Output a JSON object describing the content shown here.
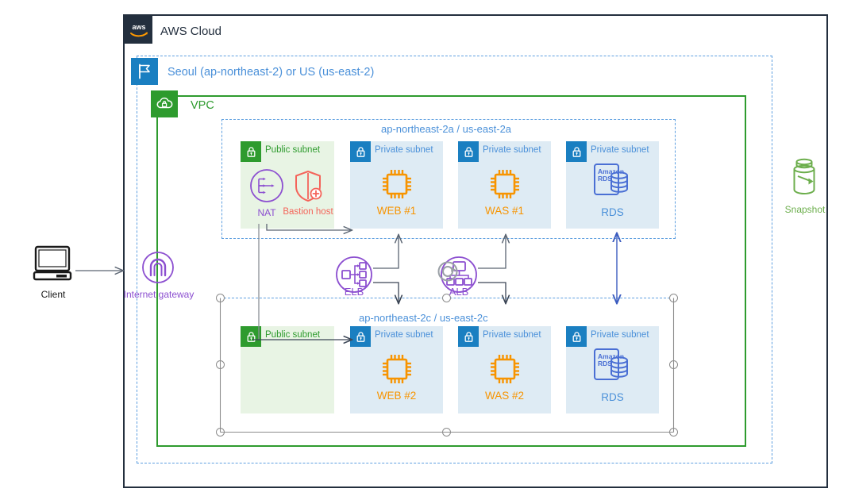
{
  "diagram": {
    "title": "AWS Cloud",
    "cloud_label": "AWS Cloud",
    "region_label": "Seoul (ap-northeast-2) or US (us-east-2)",
    "vpc_label": "VPC",
    "az_a_label": "ap-northeast-2a / us-east-2a",
    "az_c_label": "ap-northeast-2c / us-east-2c"
  },
  "colors": {
    "aws_navy": "#232F3E",
    "region_blue": "#4A90D9",
    "vpc_green": "#2E9B2E",
    "public_subnet_bg": "#E8F4E4",
    "private_subnet_bg": "#DEEBF4",
    "private_tag": "#1A7FC1",
    "ec2_orange": "#F79400",
    "purple": "#8C4FD0",
    "bastion_red": "#F4645A",
    "snapshot_green": "#6CAE4C",
    "rds_blue": "#4A6FD4",
    "arrow_gray": "#5A6472",
    "rds_arrow_blue": "#3A5BBF"
  },
  "external_nodes": [
    {
      "id": "client",
      "label": "Client",
      "icon": "desktop-computer-icon",
      "color": "#1A1A1A"
    },
    {
      "id": "internet-gateway",
      "label": "Internet gateway",
      "icon": "internet-gateway-icon",
      "color": "#8C4FD0"
    },
    {
      "id": "snapshot",
      "label": "Snapshot",
      "icon": "snapshot-icon",
      "color": "#6CAE4C"
    }
  ],
  "load_balancers": [
    {
      "id": "elb",
      "label": "ELB",
      "icon": "elastic-load-balancer-icon",
      "color": "#8C4FD0",
      "selected": false
    },
    {
      "id": "alb",
      "label": "ALB",
      "icon": "application-load-balancer-icon",
      "color": "#8C4FD0",
      "selected": true
    }
  ],
  "availability_zones": [
    {
      "id": "az-a",
      "label": "ap-northeast-2a / us-east-2a",
      "subnets": [
        {
          "id": "az-a-public",
          "type": "public",
          "label": "Public subnet",
          "tag_icon": "lock-icon",
          "resources": [
            {
              "id": "nat",
              "label": "NAT",
              "icon": "nat-gateway-icon",
              "color": "#8C4FD0"
            },
            {
              "id": "bastion",
              "label": "Bastion host",
              "icon": "bastion-host-shield-icon",
              "color": "#F4645A"
            }
          ]
        },
        {
          "id": "az-a-web",
          "type": "private",
          "label": "Private subnet",
          "tag_icon": "lock-icon",
          "resources": [
            {
              "id": "web1",
              "label": "WEB #1",
              "icon": "ec2-instance-icon",
              "color": "#F79400"
            }
          ]
        },
        {
          "id": "az-a-was",
          "type": "private",
          "label": "Private subnet",
          "tag_icon": "lock-icon",
          "resources": [
            {
              "id": "was1",
              "label": "WAS #1",
              "icon": "ec2-instance-icon",
              "color": "#F79400"
            }
          ]
        },
        {
          "id": "az-a-rds",
          "type": "private",
          "label": "Private subnet",
          "tag_icon": "lock-icon",
          "resources": [
            {
              "id": "rds1",
              "label": "RDS",
              "icon": "amazon-rds-icon",
              "color": "#4A90D9",
              "icon_text": [
                "Amazon",
                "RDS"
              ]
            }
          ]
        }
      ]
    },
    {
      "id": "az-c",
      "label": "ap-northeast-2c / us-east-2c",
      "subnets": [
        {
          "id": "az-c-public",
          "type": "public",
          "label": "Public subnet",
          "tag_icon": "lock-icon",
          "resources": []
        },
        {
          "id": "az-c-web",
          "type": "private",
          "label": "Private subnet",
          "tag_icon": "lock-icon",
          "resources": [
            {
              "id": "web2",
              "label": "WEB #2",
              "icon": "ec2-instance-icon",
              "color": "#F79400"
            }
          ]
        },
        {
          "id": "az-c-was",
          "type": "private",
          "label": "Private subnet",
          "tag_icon": "lock-icon",
          "resources": [
            {
              "id": "was2",
              "label": "WAS #2",
              "icon": "ec2-instance-icon",
              "color": "#F79400"
            }
          ]
        },
        {
          "id": "az-c-rds",
          "type": "private",
          "label": "Private subnet",
          "tag_icon": "lock-icon",
          "resources": [
            {
              "id": "rds2",
              "label": "RDS",
              "icon": "amazon-rds-icon",
              "color": "#4A90D9",
              "icon_text": [
                "Amazon",
                "RDS"
              ]
            }
          ]
        }
      ]
    }
  ],
  "selection": {
    "target": "az-c",
    "handle_count": 8,
    "rotate_handle": true
  }
}
